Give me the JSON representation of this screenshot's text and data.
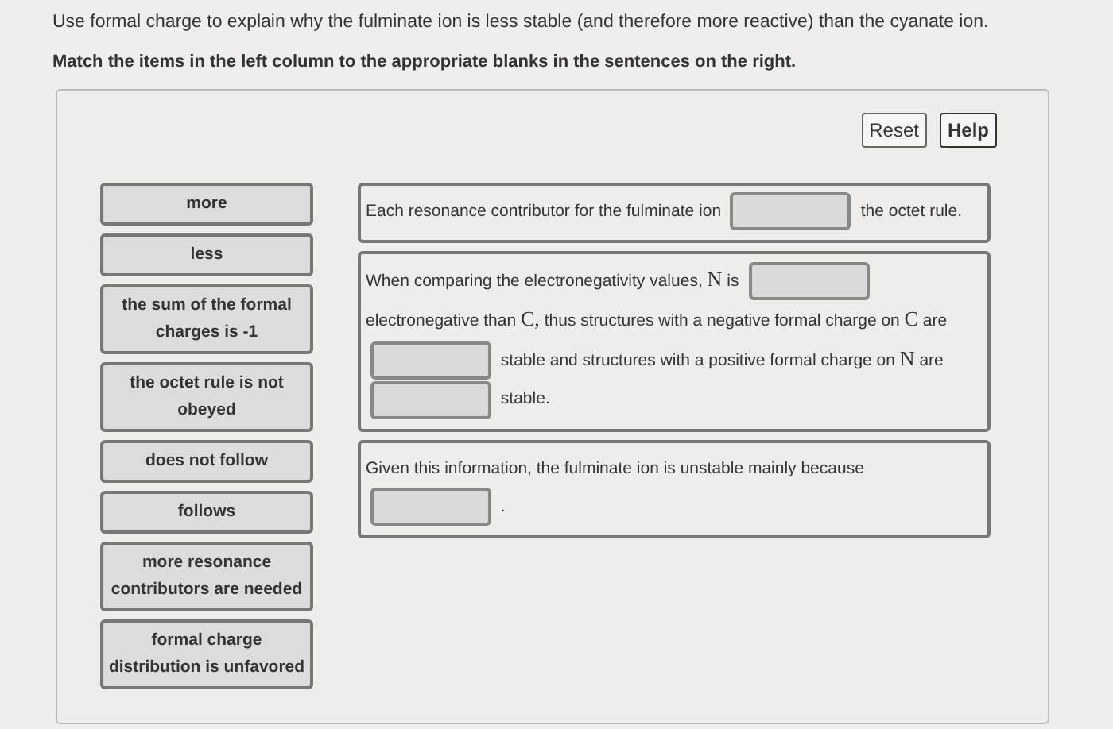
{
  "prompt": "Use formal charge to explain why the fulminate ion is less stable (and therefore more reactive) than the cyanate ion.",
  "instruction": "Match the items in the left column to the appropriate blanks in the sentences on the right.",
  "buttons": [
    "Reset",
    "Help"
  ],
  "items": [
    "more",
    "less",
    "the sum of the formal charges is -1",
    "the octet rule is not obeyed",
    "does not follow",
    "follows",
    "more resonance contributors are needed",
    "formal charge distribution is unfavored"
  ],
  "sentences": [
    {
      "parts": [
        {
          "kind": "text",
          "text": "Each resonance contributor for the fulminate ion"
        },
        {
          "kind": "blank"
        },
        {
          "kind": "text",
          "text": "the octet rule."
        }
      ]
    },
    {
      "parts": [
        {
          "kind": "text",
          "text": "When comparing the electronegativity values,"
        },
        {
          "kind": "symbol",
          "text": "N"
        },
        {
          "kind": "text",
          "text": "is"
        },
        {
          "kind": "blank"
        },
        {
          "kind": "text",
          "text": "electronegative than"
        },
        {
          "kind": "symbol",
          "text": "C,"
        },
        {
          "kind": "text",
          "text": "thus structures with a negative formal charge on"
        },
        {
          "kind": "symbol",
          "text": "C"
        },
        {
          "kind": "text",
          "text": "are"
        },
        {
          "kind": "blank"
        },
        {
          "kind": "text",
          "text": "stable and structures with a positive formal charge on"
        },
        {
          "kind": "symbol",
          "text": "N"
        },
        {
          "kind": "text",
          "text": "are"
        },
        {
          "kind": "blank"
        },
        {
          "kind": "text",
          "text": "stable."
        }
      ]
    },
    {
      "parts": [
        {
          "kind": "text",
          "text": "Given this information, the fulminate ion is unstable mainly because"
        },
        {
          "kind": "blank"
        },
        {
          "kind": "text",
          "text": "."
        }
      ]
    }
  ]
}
